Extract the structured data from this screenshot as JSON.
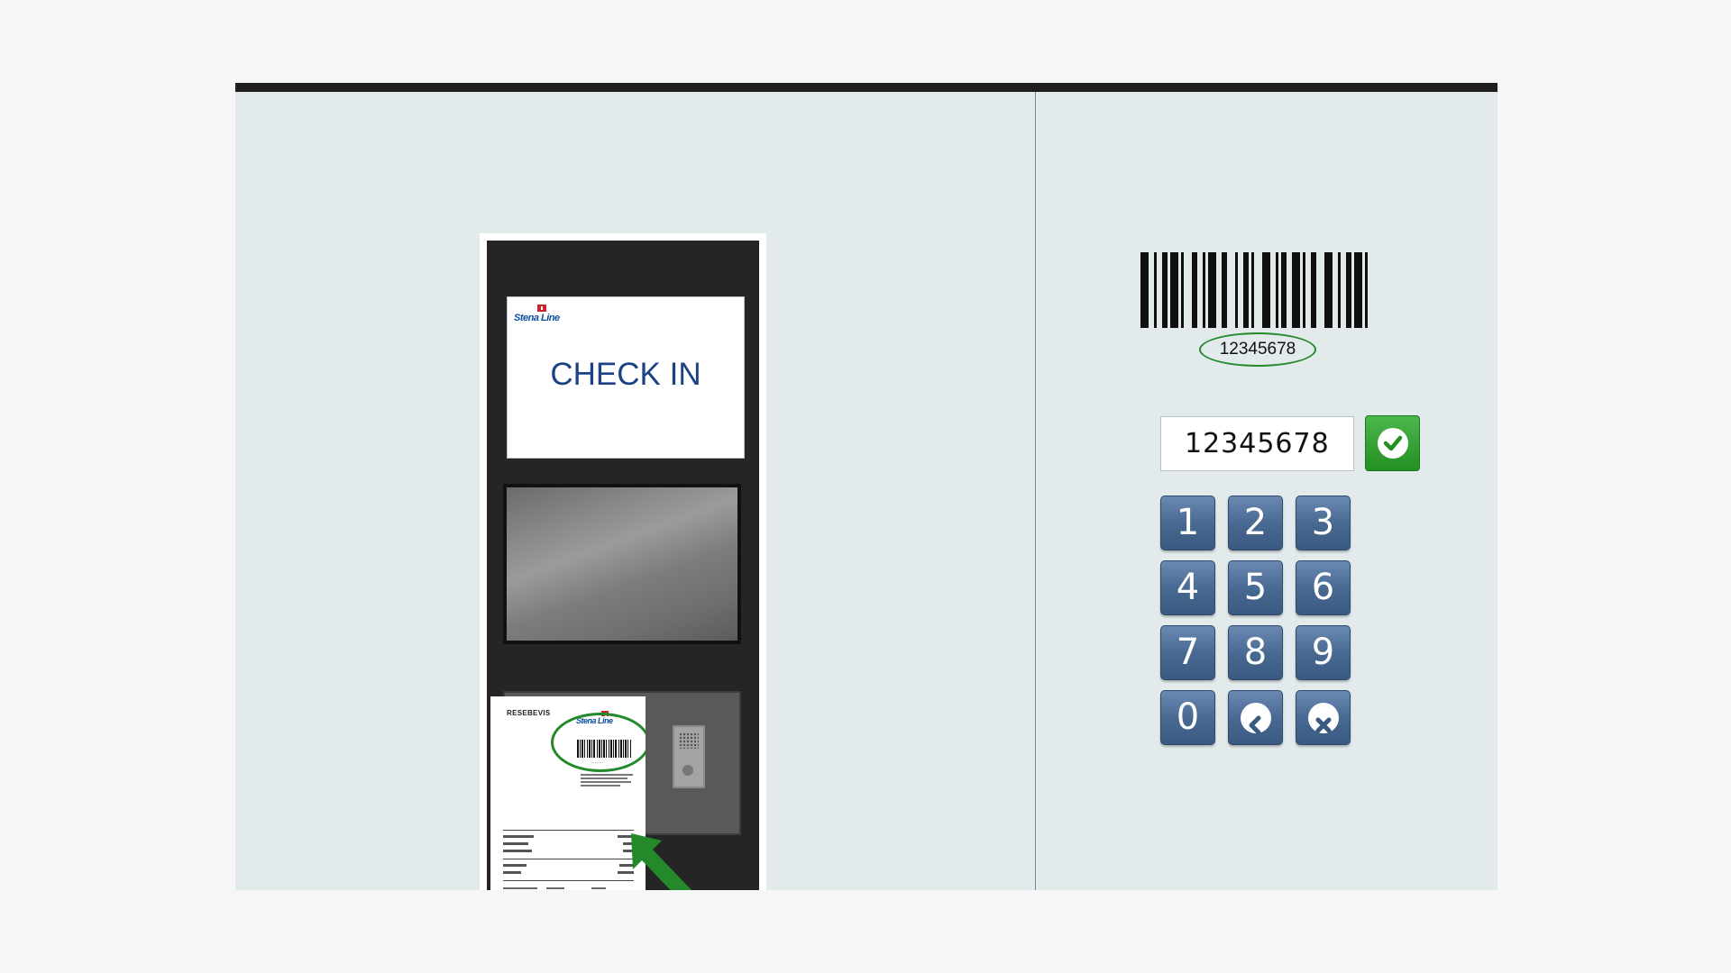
{
  "kiosk": {
    "screen_brand": "Stena Line",
    "screen_title": "CHECK IN",
    "receipt_title": "RESEBEVIS",
    "receipt_brand": "Stena Line"
  },
  "barcode": {
    "number": "12345678"
  },
  "entry": {
    "value": "12345678"
  },
  "keypad": {
    "keys": [
      "1",
      "2",
      "3",
      "4",
      "5",
      "6",
      "7",
      "8",
      "9",
      "0"
    ]
  },
  "icons": {
    "confirm": "check-icon",
    "back": "chevron-left-icon",
    "clear": "close-icon"
  },
  "colors": {
    "confirm_green": "#239023",
    "key_blue": "#46678f",
    "brand_blue": "#1b4283",
    "highlight_green": "#23892b"
  }
}
